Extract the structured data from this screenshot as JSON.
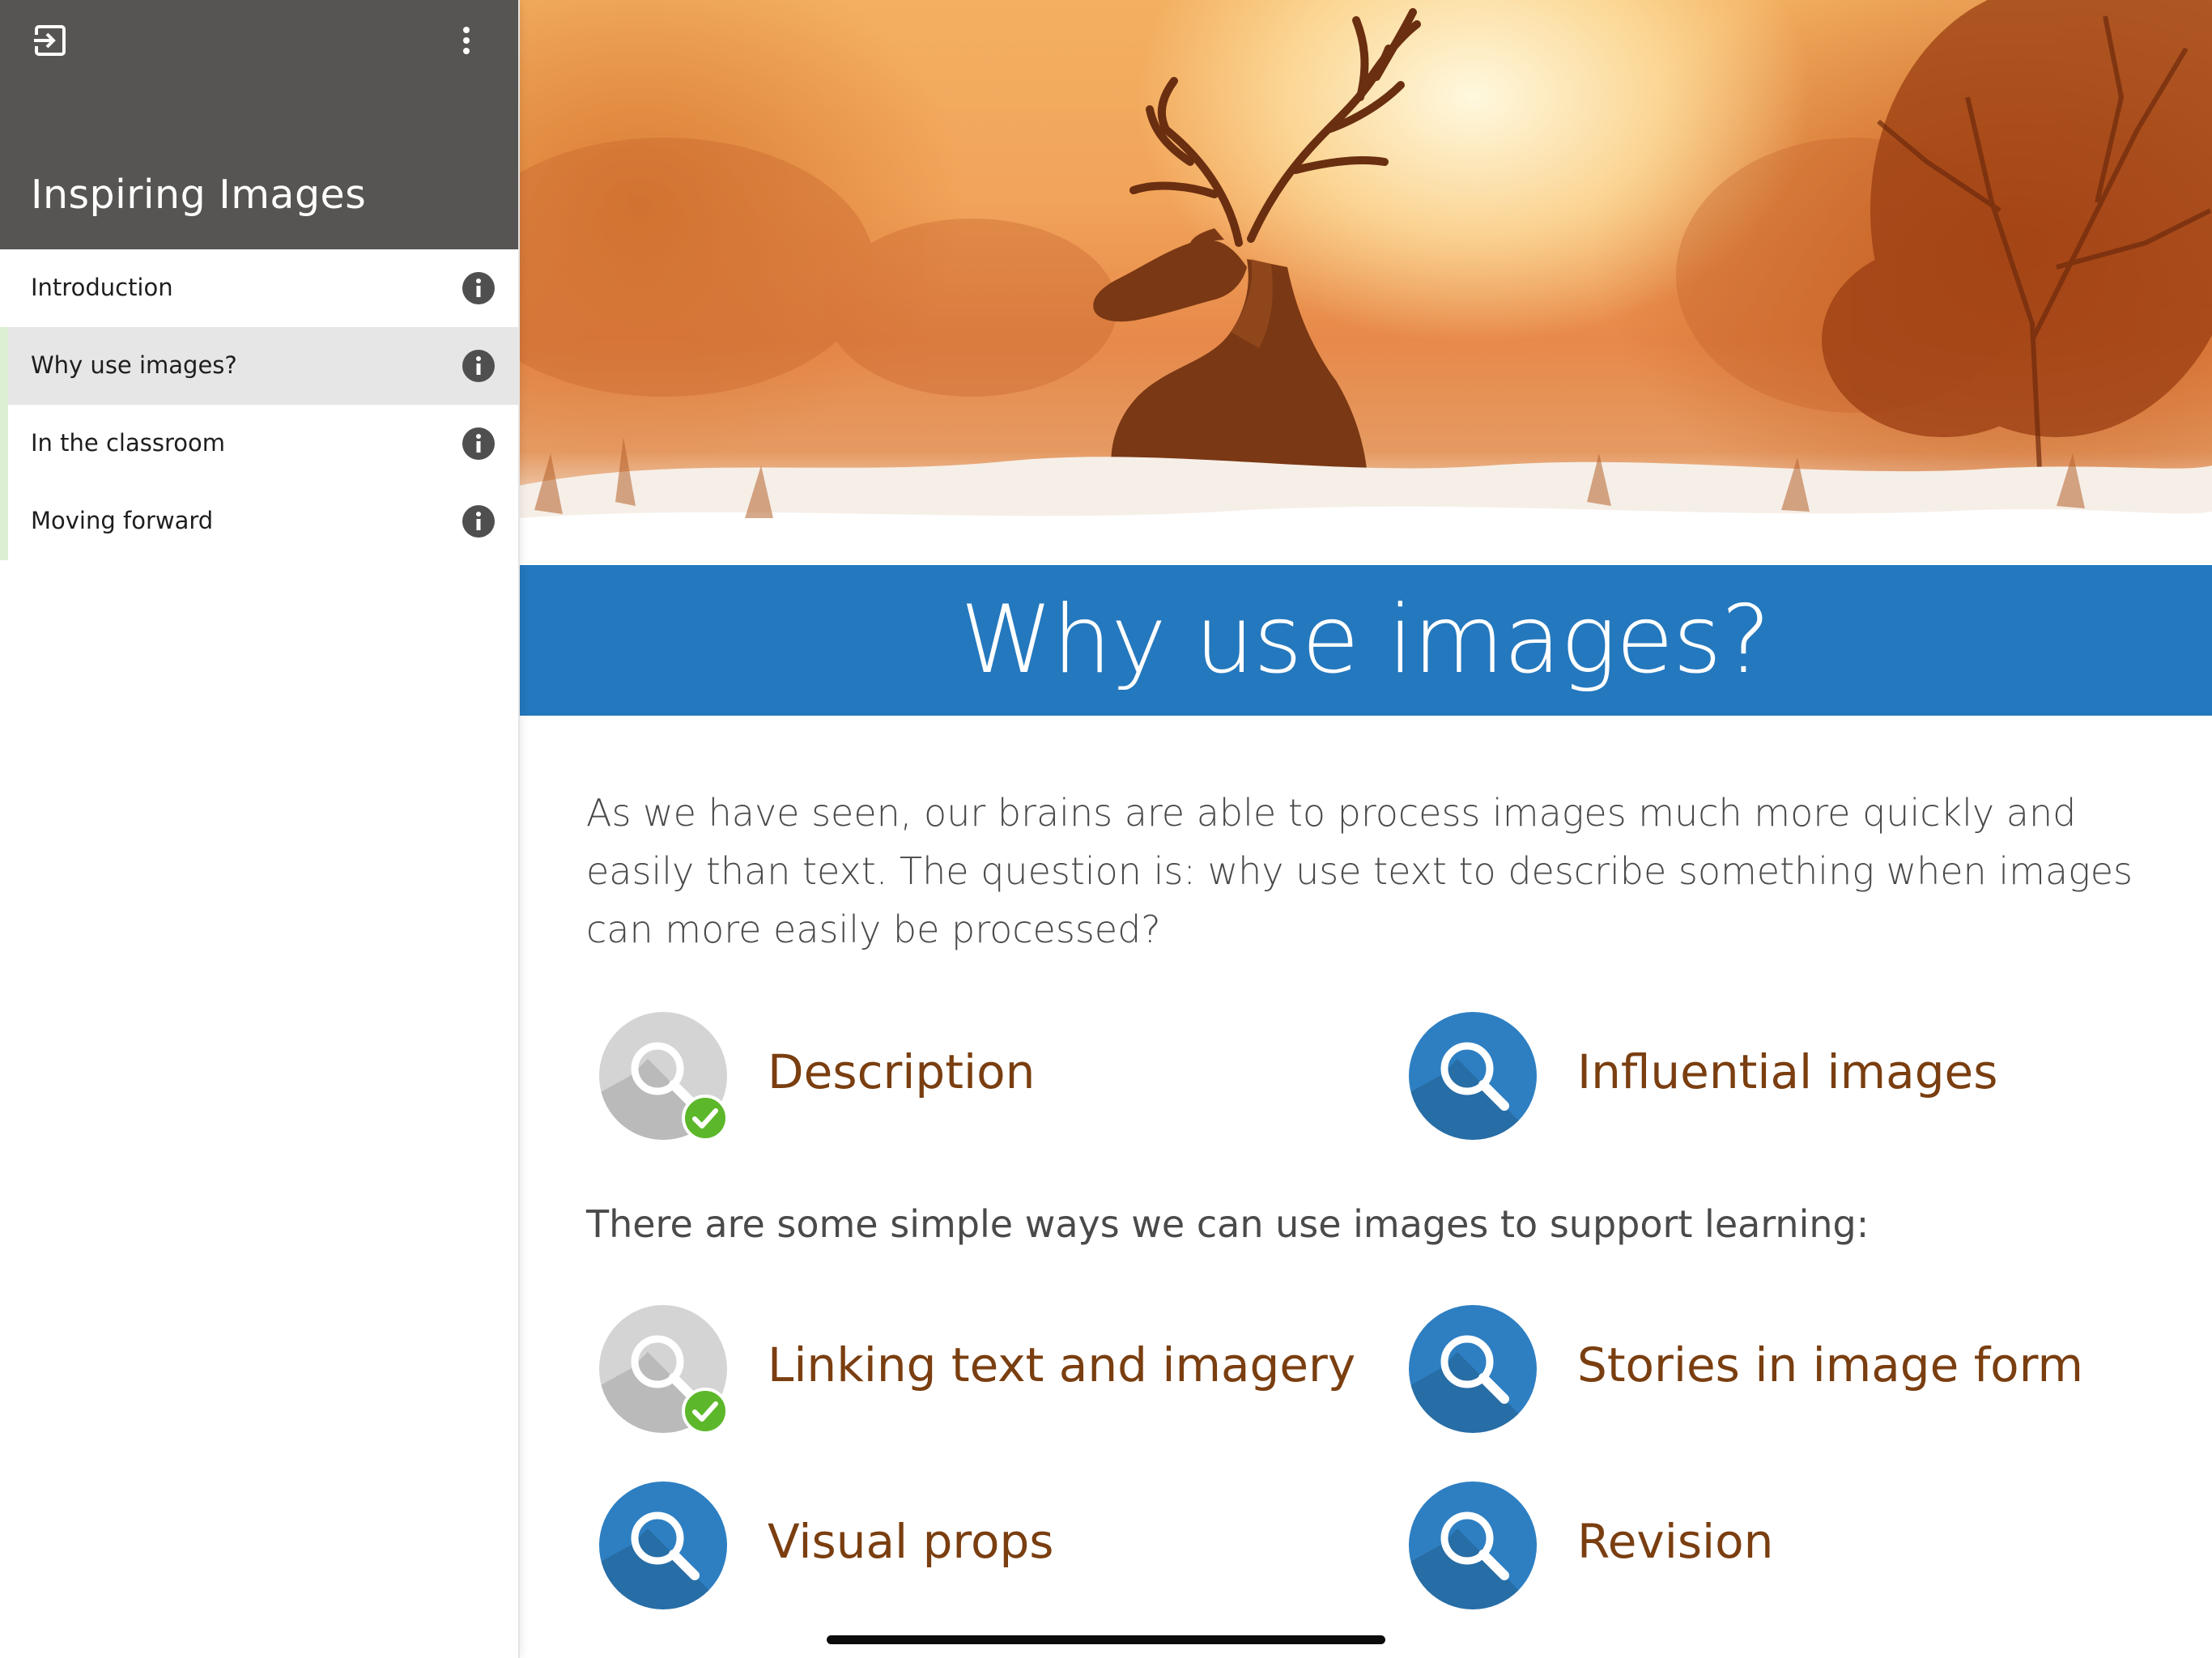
{
  "sidebar": {
    "title": "Inspiring Images",
    "items": [
      {
        "label": "Introduction",
        "active": false
      },
      {
        "label": "Why use images?",
        "active": true
      },
      {
        "label": "In the classroom",
        "active": false
      },
      {
        "label": "Moving forward",
        "active": false
      }
    ],
    "icons": {
      "exit": "exit-icon",
      "more": "more-vertical-icon",
      "info": "info-icon"
    }
  },
  "main": {
    "hero_image": "stag-at-sunrise-photo",
    "heading": "Why use images?",
    "intro": "As we have seen, our brains are able to process images much more quickly and easily than text. The question is: why use text to describe something when images can more easily be processed?",
    "topics_top": [
      {
        "label": "Description",
        "completed": true
      },
      {
        "label": "Influential images",
        "completed": false
      }
    ],
    "sub_intro": "There are some simple ways we can use images to support learning:",
    "topics_bottom": [
      {
        "label": "Linking text and imagery",
        "completed": true
      },
      {
        "label": "Stories in image form",
        "completed": false
      },
      {
        "label": "Visual props",
        "completed": false
      },
      {
        "label": "Revision",
        "completed": false
      }
    ]
  },
  "colors": {
    "sidebar_header": "#575553",
    "banner": "#2478be",
    "topic_blue": "#2e7fc2",
    "topic_done": "#d4d4d4",
    "check_green": "#5cb82a",
    "topic_text": "#7a3e10"
  }
}
